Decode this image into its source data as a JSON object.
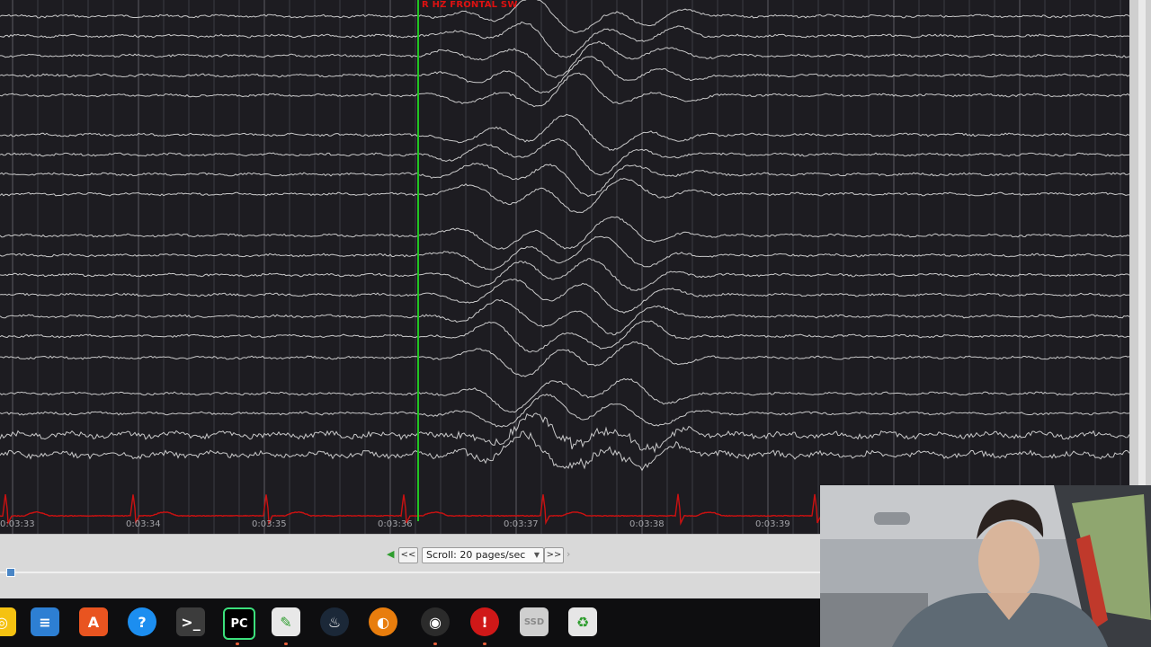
{
  "annotation": {
    "text": "R HZ FRONTAL SW"
  },
  "time_axis": {
    "labels": [
      "0:03:33",
      "0:03:34",
      "0:03:35",
      "0:03:36",
      "0:03:37",
      "0:03:38",
      "0:03:39"
    ]
  },
  "controls": {
    "scroll_rate": "Scroll: 20 pages/sec",
    "rewind_label": "<<",
    "forward_label": ">>",
    "timeline_progress": 0.008
  },
  "taskbar": {
    "apps": [
      {
        "name": "rhythmbox-icon",
        "glyph": "◎",
        "color": "#f5c211"
      },
      {
        "name": "writer-document-icon",
        "glyph": "≡",
        "color": "#2d7fd3"
      },
      {
        "name": "software-center-icon",
        "glyph": "A",
        "color": "#e95420"
      },
      {
        "name": "help-icon",
        "glyph": "?",
        "color": "#1c8ef0"
      },
      {
        "name": "terminal-icon",
        "glyph": ">_",
        "color": "#3c3c3c"
      },
      {
        "name": "pycharm-icon",
        "glyph": "PC",
        "color": "#000000"
      },
      {
        "name": "text-editor-icon",
        "glyph": "✎",
        "color": "#e8e8e8"
      },
      {
        "name": "steam-icon",
        "glyph": "♨",
        "color": "#1b2838"
      },
      {
        "name": "blender-icon",
        "glyph": "◐",
        "color": "#e87d0d"
      },
      {
        "name": "obs-icon",
        "glyph": "◉",
        "color": "#2b2b2b"
      },
      {
        "name": "error-alert-icon",
        "glyph": "!",
        "color": "#d01818"
      },
      {
        "name": "ssd-drive-icon",
        "glyph": "SSD",
        "color": "#cfcfcf"
      },
      {
        "name": "trash-icon",
        "glyph": "♻",
        "color": "#e6e6e6"
      }
    ]
  },
  "colors": {
    "background": "#1d1c21",
    "trace": "#e6e6e6",
    "ecg": "#cc1111",
    "marker": "#22c422",
    "annotation": "#dd1111"
  }
}
